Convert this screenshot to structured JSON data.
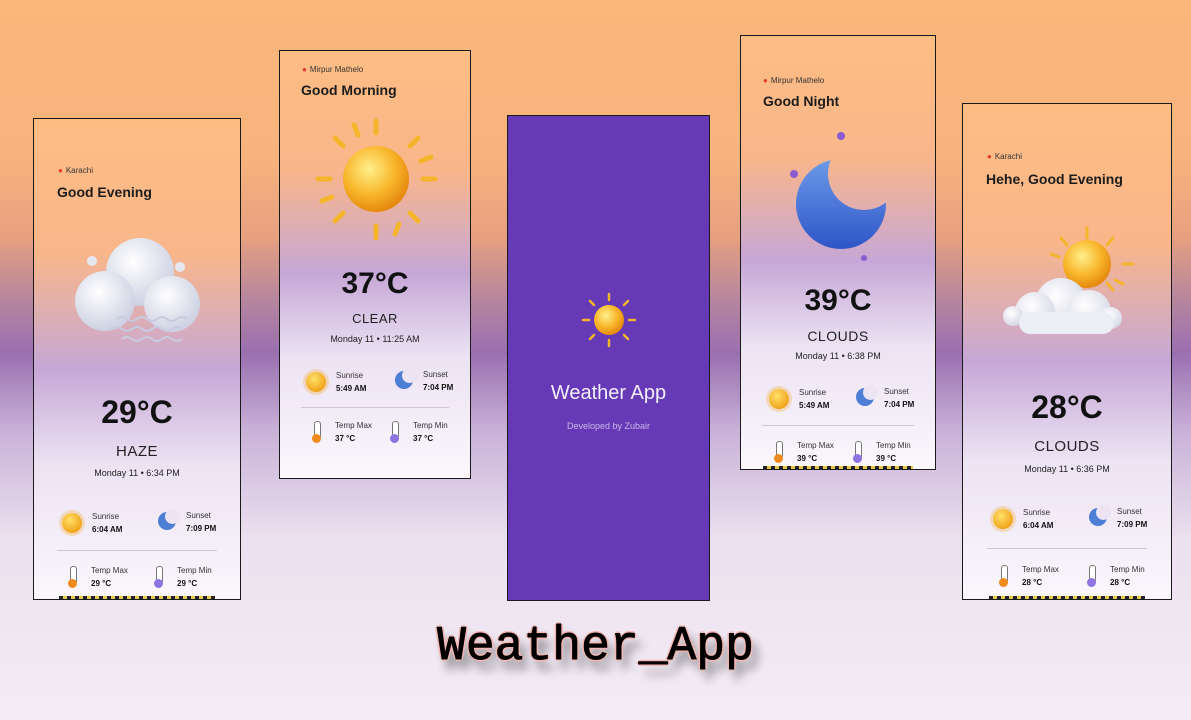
{
  "phones": [
    {
      "location": "Karachi",
      "greeting": "Good Evening",
      "temperature": "29°C",
      "condition": "HAZE",
      "date": "Monday 11 • 6:34 PM",
      "sunrise_label": "Sunrise",
      "sunrise": "6:04 AM",
      "sunset_label": "Sunset",
      "sunset": "7:09 PM",
      "temp_max_label": "Temp Max",
      "temp_max": "29 °C",
      "temp_min_label": "Temp Min",
      "temp_min": "29 °C"
    },
    {
      "location": "Mirpur Mathelo",
      "greeting": "Good Morning",
      "temperature": "37°C",
      "condition": "CLEAR",
      "date": "Monday 11 • 11:25 AM",
      "sunrise_label": "Sunrise",
      "sunrise": "5:49 AM",
      "sunset_label": "Sunset",
      "sunset": "7:04 PM",
      "temp_max_label": "Temp Max",
      "temp_max": "37 °C",
      "temp_min_label": "Temp Min",
      "temp_min": "37 °C"
    },
    {
      "location": "Mirpur Mathelo",
      "greeting": "Good Night",
      "temperature": "39°C",
      "condition": "CLOUDS",
      "date": "Monday 11 • 6:38 PM",
      "sunrise_label": "Sunrise",
      "sunrise": "5:49 AM",
      "sunset_label": "Sunset",
      "sunset": "7:04 PM",
      "temp_max_label": "Temp Max",
      "temp_max": "39 °C",
      "temp_min_label": "Temp Min",
      "temp_min": "39 °C"
    },
    {
      "location": "Karachi",
      "greeting": "Hehe, Good Evening",
      "temperature": "28°C",
      "condition": "CLOUDS",
      "date": "Monday 11 • 6:36 PM",
      "sunrise_label": "Sunrise",
      "sunrise": "6:04 AM",
      "sunset_label": "Sunset",
      "sunset": "7:09 PM",
      "temp_max_label": "Temp Max",
      "temp_max": "28 °C",
      "temp_min_label": "Temp Min",
      "temp_min": "28 °C"
    }
  ],
  "splash": {
    "title": "Weather App",
    "subtitle": "Developed by Zubair",
    "background": "#663ab6"
  },
  "banner": {
    "text": "Weather_App"
  }
}
